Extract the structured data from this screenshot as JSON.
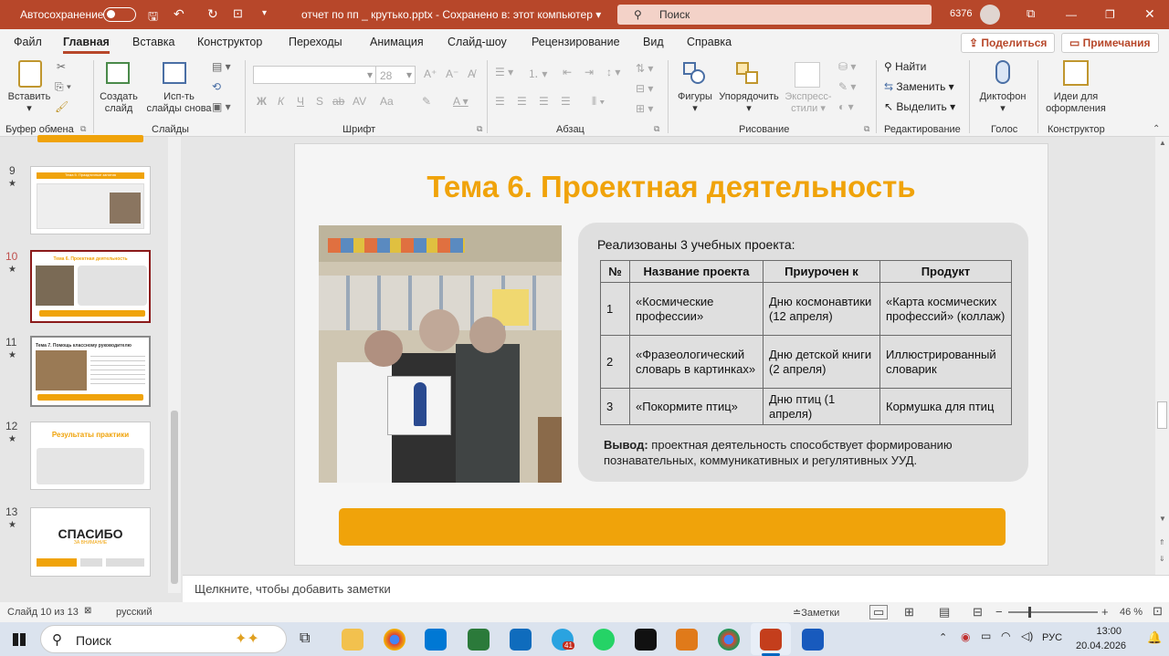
{
  "titlebar": {
    "autosave_label": "Автосохранение",
    "file_title": "отчет по пп _ крутько.pptx  -  Сохранено в: этот компьютер",
    "search_placeholder": "Поиск",
    "counter": "6376",
    "bg_color": "#b7472a"
  },
  "menu": {
    "items": [
      "Файл",
      "Главная",
      "Вставка",
      "Конструктор",
      "Переходы",
      "Анимация",
      "Слайд-шоу",
      "Рецензирование",
      "Вид",
      "Справка"
    ],
    "share_label": "Поделиться",
    "comments_label": "Примечания"
  },
  "ribbon": {
    "paste": "Вставить",
    "new_slide": "Создать слайд",
    "reuse": "Исп-ть слайды снова",
    "font_size": "28",
    "shapes": "Фигуры",
    "arrange": "Упорядочить",
    "styles": "Экспресс-стили",
    "find": "Найти",
    "replace": "Заменить",
    "select": "Выделить",
    "dictate": "Диктофон",
    "designer": "Идеи для оформления",
    "groups": [
      "Буфер обмена",
      "Слайды",
      "Шрифт",
      "Абзац",
      "Рисование",
      "Редактирование",
      "Голос",
      "Конструктор"
    ],
    "font_buttons": [
      "Ж",
      "К",
      "Ч",
      "S",
      "ab",
      "AV",
      "Aa"
    ]
  },
  "thumbnails": [
    {
      "num": "9",
      "title": "Тема 5. Праздничные занятия"
    },
    {
      "num": "10",
      "title": "Тема 6. Проектная деятельность"
    },
    {
      "num": "11",
      "title": "Тема 7. Помощь классному руководителю"
    },
    {
      "num": "12",
      "title": "Результаты практики"
    },
    {
      "num": "13",
      "title": "СПАСИБО",
      "subtitle": "ЗА ВНИМАНИЕ"
    }
  ],
  "slide": {
    "title": "Тема 6. Проектная деятельность",
    "intro": "Реализованы 3 учебных проекта:",
    "table": {
      "headers": [
        "№",
        "Название проекта",
        "Приурочен к",
        "Продукт"
      ],
      "rows": [
        [
          "1",
          "«Космические профессии»",
          "Дню космонавтики (12 апреля)",
          "«Карта космических профессий» (коллаж)"
        ],
        [
          "2",
          "«Фразеологический словарь в картинках»",
          "Дню детской книги (2 апреля)",
          "Иллюстрированный словарик"
        ],
        [
          "3",
          "«Покормите птиц»",
          "Дню птиц (1 апреля)",
          "Кормушка для птиц"
        ]
      ]
    },
    "conclusion_label": "Вывод:",
    "conclusion_text": "проектная деятельность способствует формированию познавательных, коммуникативных и регулятивных УУД.",
    "accent_color": "#f0a30a"
  },
  "notes_placeholder": "Щелкните, чтобы добавить заметки",
  "status": {
    "slide_counter": "Слайд 10 из 13",
    "language": "русский",
    "notes_btn": "Заметки",
    "zoom": "46 %"
  },
  "taskbar": {
    "search": "Поиск",
    "lang": "РУС",
    "time": "13:00",
    "date": "20.04.2026",
    "telegram_badge": "41"
  }
}
